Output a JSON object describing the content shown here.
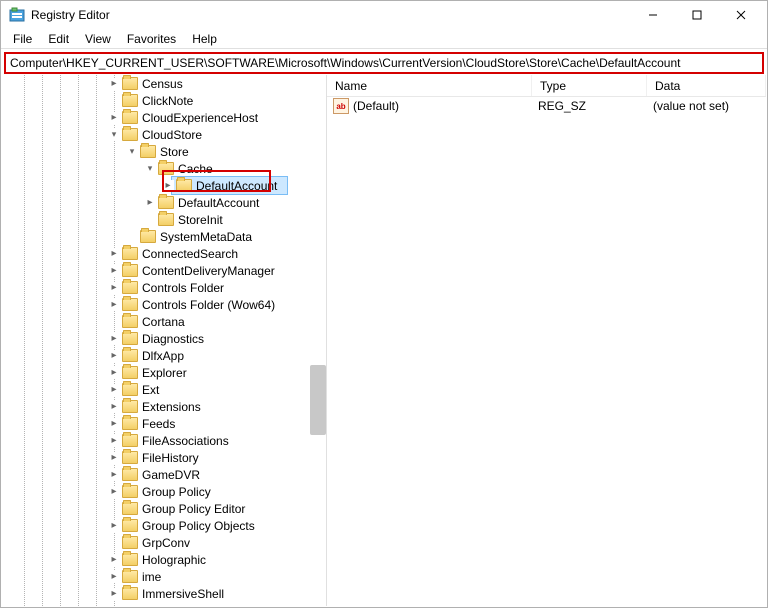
{
  "window": {
    "title": "Registry Editor"
  },
  "menu": {
    "file": "File",
    "edit": "Edit",
    "view": "View",
    "favorites": "Favorites",
    "help": "Help"
  },
  "address": "Computer\\HKEY_CURRENT_USER\\SOFTWARE\\Microsoft\\Windows\\CurrentVersion\\CloudStore\\Store\\Cache\\DefaultAccount",
  "tree": {
    "census": "Census",
    "clicknote": "ClickNote",
    "cloudexp": "CloudExperienceHost",
    "cloudstore": "CloudStore",
    "store": "Store",
    "cache": "Cache",
    "defaultaccount1": "DefaultAccount",
    "defaultaccount2": "DefaultAccount",
    "storeinit": "StoreInit",
    "systemmetadata": "SystemMetaData",
    "connectedsearch": "ConnectedSearch",
    "cdm": "ContentDeliveryManager",
    "controlsfolder": "Controls Folder",
    "controlsfolderwow": "Controls Folder (Wow64)",
    "cortana": "Cortana",
    "diagnostics": "Diagnostics",
    "dlfxapp": "DlfxApp",
    "explorer": "Explorer",
    "ext": "Ext",
    "extensions": "Extensions",
    "feeds": "Feeds",
    "fileassoc": "FileAssociations",
    "filehistory": "FileHistory",
    "gamedvr": "GameDVR",
    "grouppolicy": "Group Policy",
    "gpe": "Group Policy Editor",
    "gpo": "Group Policy Objects",
    "grpconv": "GrpConv",
    "holographic": "Holographic",
    "ime": "ime",
    "immersive": "ImmersiveShell"
  },
  "list": {
    "cols": {
      "name": "Name",
      "type": "Type",
      "data": "Data"
    },
    "row1": {
      "name": "(Default)",
      "type": "REG_SZ",
      "data": "(value not set)"
    }
  }
}
